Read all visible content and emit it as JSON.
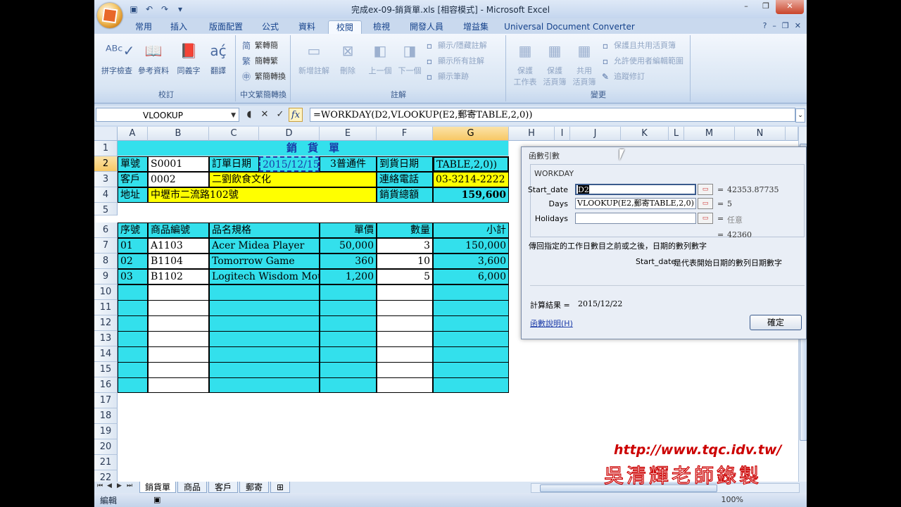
{
  "window": {
    "title": "完成ex-09-銷貨單.xls  [相容模式] - Microsoft Excel",
    "controls": [
      "–",
      "❐",
      "✕"
    ]
  },
  "ribbon_tabs": [
    "常用",
    "插入",
    "版面配置",
    "公式",
    "資料",
    "校閱",
    "檢視",
    "開發人員",
    "增益集",
    "Universal Document Converter"
  ],
  "active_tab": "校閱",
  "ribbon": {
    "proofing": {
      "label": "校訂",
      "buttons": [
        "拼字檢查",
        "參考資料",
        "同義字",
        "翻譯"
      ]
    },
    "chinese_conv": {
      "label": "中文繁簡轉換",
      "buttons": [
        "繁轉簡",
        "簡轉繁",
        "繁簡轉換"
      ]
    },
    "comments": {
      "label": "註解",
      "buttons": [
        "新增註解",
        "刪除",
        "上一個",
        "下一個"
      ],
      "small": [
        "顯示/隱藏註解",
        "顯示所有註解",
        "顯示筆跡"
      ]
    },
    "changes": {
      "label": "變更",
      "buttons": [
        "保護\n工作表",
        "保護\n活頁簿",
        "共用\n活頁簿"
      ],
      "small": [
        "保護且共用活頁簿",
        "允許使用者編輯範圍",
        "追蹤修訂"
      ]
    }
  },
  "name_box": "VLOOKUP",
  "formula": "=WORKDAY(D2,VLOOKUP(E2,郵寄TABLE,2,0))",
  "columns": [
    "A",
    "B",
    "C",
    "D",
    "E",
    "F",
    "G",
    "H",
    "I",
    "J",
    "K",
    "L",
    "M",
    "N"
  ],
  "rows": [
    "1",
    "2",
    "3",
    "4",
    "5",
    "6",
    "7",
    "8",
    "9",
    "10",
    "11",
    "12",
    "13",
    "14",
    "15",
    "16",
    "17",
    "18",
    "19",
    "20",
    "21",
    "22"
  ],
  "sheet": {
    "title": "銷　貨　單",
    "r2": {
      "a": "單號",
      "b": "S0001",
      "c": "訂單日期",
      "d": "2015/12/15",
      "e": "3普通件",
      "f": "到貨日期",
      "g": "TABLE,2,0))"
    },
    "r3": {
      "a": "客戶",
      "b": "0002",
      "c": "二劉飲食文化",
      "f": "連絡電話",
      "g": "03-3214-2222"
    },
    "r4": {
      "a": "地址",
      "b": "中壢市二流路102號",
      "f": "銷貨總額",
      "g": "159,600"
    },
    "headers": {
      "a": "序號",
      "b": "商品編號",
      "c": "品名規格",
      "e": "單價",
      "f": "數量",
      "g": "小計"
    },
    "items": [
      {
        "seq": "01",
        "code": "A1103",
        "name": "Acer Midea Player",
        "price": "50,000",
        "qty": "3",
        "sub": "150,000"
      },
      {
        "seq": "02",
        "code": "B1104",
        "name": "Tomorrow Game",
        "price": "360",
        "qty": "10",
        "sub": "3,600"
      },
      {
        "seq": "03",
        "code": "B1102",
        "name": "Logitech Wisdom Mouse",
        "price": "1,200",
        "qty": "5",
        "sub": "6,000"
      }
    ]
  },
  "sheet_tabs": [
    "銷貨單",
    "商品",
    "客戶",
    "郵寄"
  ],
  "active_sheet": "銷貨單",
  "status": "編輯",
  "zoom": "100%",
  "dialog": {
    "title": "函數引數",
    "function": "WORKDAY",
    "args": [
      {
        "label": "Start_date",
        "value": "D2",
        "result": "42353.87735"
      },
      {
        "label": "Days",
        "value": "VLOOKUP(E2,郵寄TABLE,2,0)",
        "result": "5"
      },
      {
        "label": "Holidays",
        "value": "",
        "result": "任意"
      }
    ],
    "total": "42360",
    "description": "傳回指定的工作日數目之前或之後，日期的數列數字",
    "arg_desc_name": "Start_date",
    "arg_desc": "是代表開始日期的數列日期數字",
    "result_label": "計算結果 =",
    "result_value": "2015/12/22",
    "help_link": "函數說明(H)",
    "ok": "確定"
  },
  "watermark": {
    "url": "http://www.tqc.idv.tw/",
    "name": "吳清輝老師錄製"
  }
}
